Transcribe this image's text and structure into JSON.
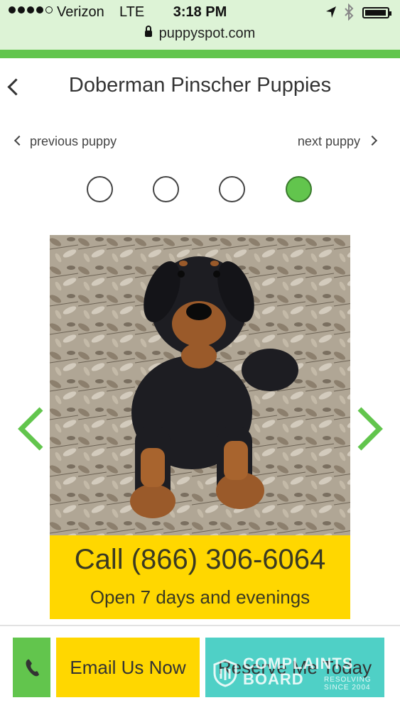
{
  "status_bar": {
    "carrier": "Verizon",
    "network": "LTE",
    "time": "3:18 PM"
  },
  "browser": {
    "url": "puppyspot.com"
  },
  "header": {
    "title": "Doberman Pinscher Puppies"
  },
  "nav": {
    "previous_label": "previous puppy",
    "next_label": "next puppy"
  },
  "gallery": {
    "dot_count": 4,
    "active_dot": 4
  },
  "call_box": {
    "phone": "Call (866) 306-6064",
    "hours": "Open 7 days and evenings"
  },
  "actions": {
    "email_label": "Email Us Now",
    "reserve_label": "Reserve Me Today"
  },
  "watermark": {
    "brand": "COMPLAINTS BOARD",
    "tagline": "RESOLVING SINCE 2004"
  },
  "colors": {
    "brand_green": "#62c54d",
    "call_yellow": "#ffd700",
    "reserve_teal": "#4fd0c6",
    "url_bar_bg": "#ddf3d6"
  }
}
